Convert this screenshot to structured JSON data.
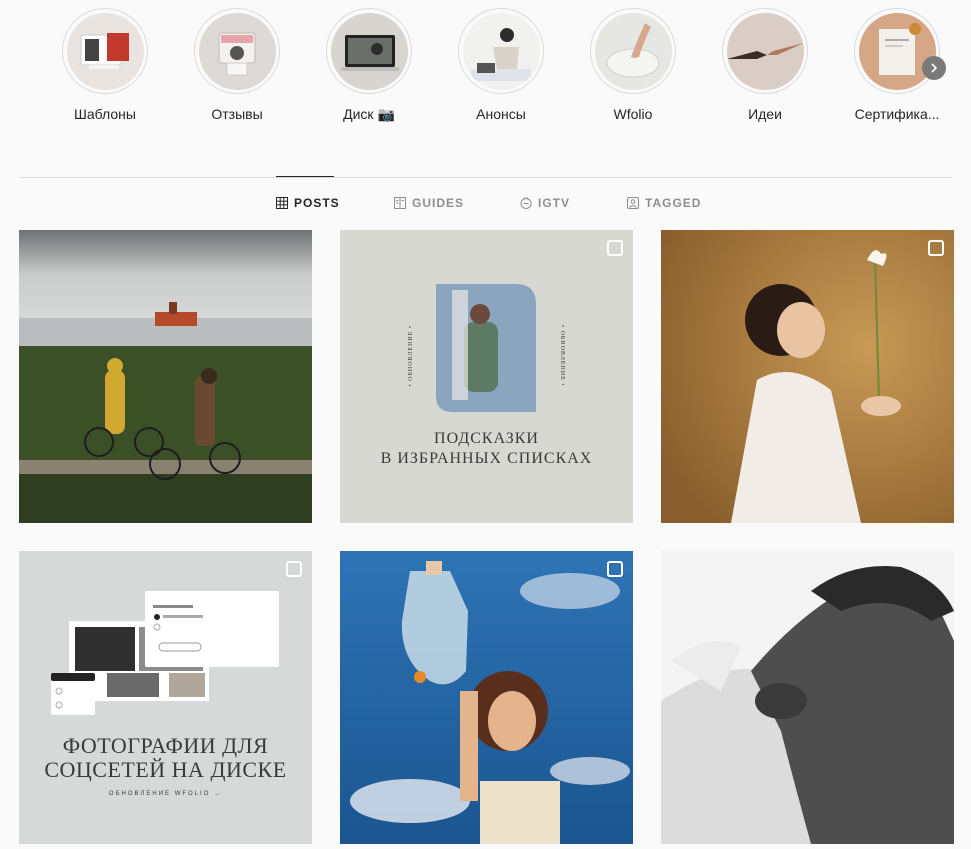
{
  "highlights": [
    {
      "label": "Шаблоны",
      "icon": "template-thumbnail"
    },
    {
      "label": "Отзывы",
      "icon": "camera-thumbnail"
    },
    {
      "label": "Диск 📷",
      "icon": "laptop-thumbnail"
    },
    {
      "label": "Анонсы",
      "icon": "workspace-thumbnail"
    },
    {
      "label": "Wfolio",
      "icon": "hand-thumbnail"
    },
    {
      "label": "Идеи",
      "icon": "handshake-thumbnail"
    },
    {
      "label": "Сертифика...",
      "icon": "certificate-thumbnail"
    }
  ],
  "highlights_next_icon": "chevron-right-icon",
  "tabs": [
    {
      "label": "POSTS",
      "icon": "grid-icon",
      "active": true
    },
    {
      "label": "GUIDES",
      "icon": "book-icon",
      "active": false
    },
    {
      "label": "IGTV",
      "icon": "igtv-icon",
      "active": false
    },
    {
      "label": "TAGGED",
      "icon": "tag-icon",
      "active": false
    }
  ],
  "posts": [
    {
      "kind": "photo",
      "subject": "couple-with-bicycles-by-sea",
      "multi": false
    },
    {
      "kind": "graphic",
      "side_label": "• ОБНОВЛЕНИЕ •",
      "text_line1": "ПОДСКАЗКИ",
      "text_line2": "В ИЗБРАННЫХ СПИСКАХ",
      "multi": true
    },
    {
      "kind": "photo",
      "subject": "person-with-lily",
      "multi": true
    },
    {
      "kind": "graphic",
      "text_line1": "ФОТОГРАФИИ ДЛЯ",
      "text_line2": "СОЦСЕТЕЙ НА ДИСКЕ",
      "footer": "ОБНОВЛЕНИЕ WFOLIO →",
      "multi": true
    },
    {
      "kind": "photo",
      "subject": "woman-holding-water-bag",
      "multi": true
    },
    {
      "kind": "photo",
      "subject": "black-and-white-horses",
      "multi": false
    }
  ],
  "colors": {
    "background": "#fafafa",
    "divider": "#dbdbdb",
    "tab_active": "#262626",
    "tab_inactive": "#8e8e8e"
  }
}
